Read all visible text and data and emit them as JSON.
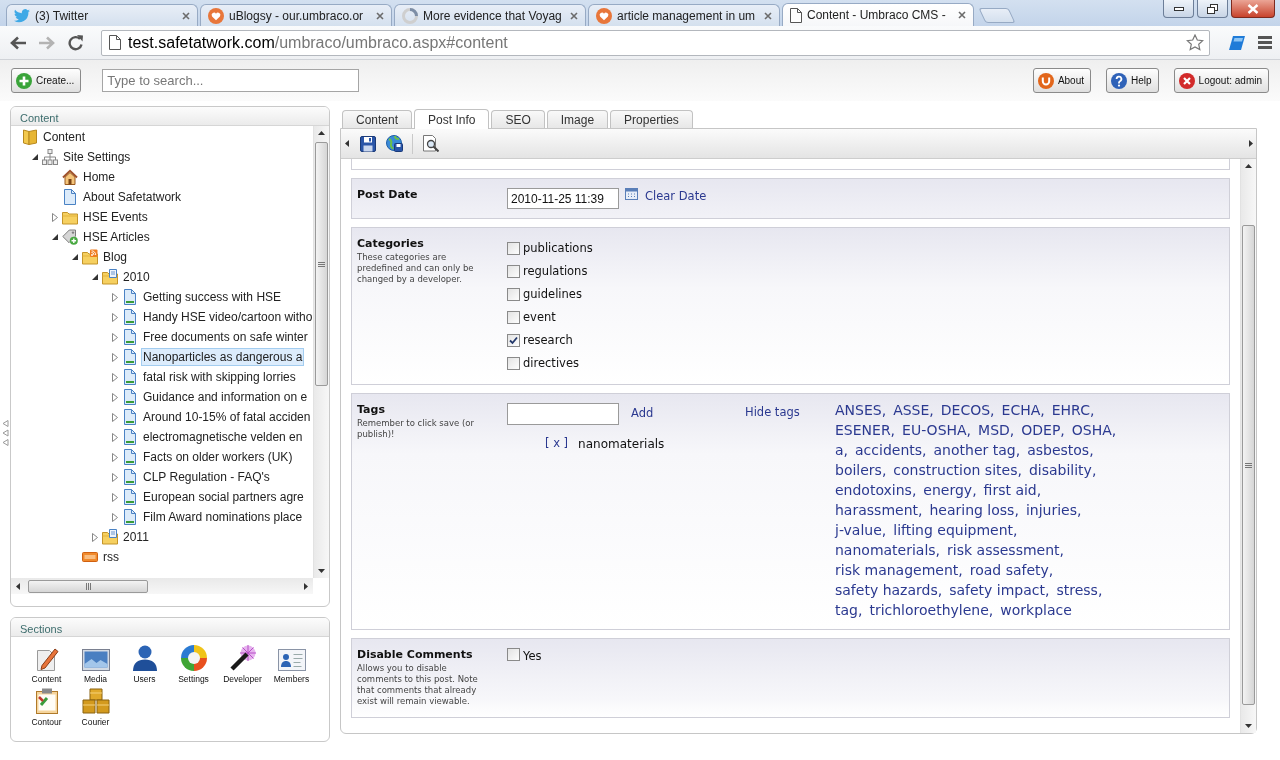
{
  "browser": {
    "tabs": [
      {
        "kind": "bird",
        "title": "(3) Twitter",
        "selected": false
      },
      {
        "kind": "heart",
        "title": "uBlogsy - our.umbraco.or",
        "selected": false
      },
      {
        "kind": "loading",
        "title": "More evidence that Voyag",
        "selected": false
      },
      {
        "kind": "heart",
        "title": "article management in um",
        "selected": false
      },
      {
        "kind": "page",
        "title": "Content - Umbraco CMS -",
        "selected": true
      }
    ],
    "address": {
      "host": "test.safetatwork.com",
      "path": "/umbraco/umbraco.aspx#content"
    }
  },
  "header": {
    "create_button": "Create...",
    "search": {
      "placeholder": "Type to search..."
    },
    "buttons": [
      {
        "kind": "about",
        "label": "About"
      },
      {
        "kind": "help",
        "label": "Help"
      },
      {
        "kind": "logout",
        "label": "Logout: admin"
      }
    ]
  },
  "content_tree": {
    "title": "Content",
    "items": [
      {
        "kind": "root",
        "label": "Content",
        "selected": false,
        "children": [
          {
            "kind": "settings",
            "label": "Site Settings",
            "expanded": true,
            "selected": false,
            "children": [
              {
                "kind": "home",
                "label": "Home",
                "selected": false
              },
              {
                "kind": "page",
                "label": "About Safetatwork",
                "selected": false
              },
              {
                "kind": "folder",
                "label": "HSE Events",
                "expanded": false,
                "selected": false
              },
              {
                "kind": "articles",
                "label": "HSE Articles",
                "expanded": true,
                "selected": false,
                "children": [
                  {
                    "kind": "blog",
                    "label": "Blog",
                    "expanded": true,
                    "selected": false,
                    "children": [
                      {
                        "kind": "year",
                        "label": "2010",
                        "expanded": true,
                        "selected": false,
                        "children": [
                          {
                            "kind": "post",
                            "label": "Getting success with HSE",
                            "expanded": false,
                            "selected": false
                          },
                          {
                            "kind": "post",
                            "label": "Handy HSE video/cartoon witho",
                            "expanded": false,
                            "selected": false
                          },
                          {
                            "kind": "post",
                            "label": "Free documents on safe winter",
                            "expanded": false,
                            "selected": false
                          },
                          {
                            "kind": "post",
                            "label": "Nanoparticles as dangerous a",
                            "expanded": false,
                            "selected": true
                          },
                          {
                            "kind": "post",
                            "label": "fatal risk with skipping lorries",
                            "expanded": false,
                            "selected": false
                          },
                          {
                            "kind": "post",
                            "label": "Guidance and information on e",
                            "expanded": false,
                            "selected": false
                          },
                          {
                            "kind": "post",
                            "label": "Around 10-15% of fatal acciden",
                            "expanded": false,
                            "selected": false
                          },
                          {
                            "kind": "post",
                            "label": "electromagnetische velden en",
                            "expanded": false,
                            "selected": false
                          },
                          {
                            "kind": "post",
                            "label": "Facts on older workers (UK)",
                            "expanded": false,
                            "selected": false
                          },
                          {
                            "kind": "post",
                            "label": "CLP Regulation - FAQ's",
                            "expanded": false,
                            "selected": false
                          },
                          {
                            "kind": "post",
                            "label": "European social partners agre",
                            "expanded": false,
                            "selected": false
                          },
                          {
                            "kind": "post",
                            "label": "Film Award nominations place",
                            "expanded": false,
                            "selected": false
                          }
                        ]
                      },
                      {
                        "kind": "year",
                        "label": "2011",
                        "expanded": false,
                        "selected": false
                      }
                    ]
                  },
                  {
                    "kind": "rss",
                    "label": "rss",
                    "selected": false
                  }
                ]
              }
            ]
          }
        ]
      }
    ]
  },
  "sections": {
    "title": "Sections",
    "items": [
      {
        "kind": "content",
        "label": "Content"
      },
      {
        "kind": "media",
        "label": "Media"
      },
      {
        "kind": "users",
        "label": "Users"
      },
      {
        "kind": "settings",
        "label": "Settings"
      },
      {
        "kind": "developer",
        "label": "Developer"
      },
      {
        "kind": "members",
        "label": "Members"
      },
      {
        "kind": "contour",
        "label": "Contour"
      },
      {
        "kind": "courier",
        "label": "Courier"
      }
    ]
  },
  "editor": {
    "tabs": [
      {
        "label": "Content",
        "selected": false
      },
      {
        "label": "Post Info",
        "selected": true
      },
      {
        "label": "SEO",
        "selected": false
      },
      {
        "label": "Image",
        "selected": false
      },
      {
        "label": "Properties",
        "selected": false
      }
    ],
    "post_date": {
      "label": "Post Date",
      "value": "2010-11-25 11:39",
      "clear_link": "Clear Date"
    },
    "categories": {
      "label": "Categories",
      "description": "These categories are predefined and can only be changed by a developer.",
      "options": [
        {
          "label": "publications",
          "checked": false
        },
        {
          "label": "regulations",
          "checked": false
        },
        {
          "label": "guidelines",
          "checked": false
        },
        {
          "label": "event",
          "checked": false
        },
        {
          "label": "research",
          "checked": true
        },
        {
          "label": "directives",
          "checked": false
        }
      ]
    },
    "tags": {
      "label": "Tags",
      "description": "Remember to click save (or publish)!",
      "add_link": "Add",
      "hide_link": "Hide tags",
      "selected_tags": [
        {
          "remove": "[ x ]",
          "label": "nanomaterials"
        }
      ],
      "cloud": [
        "ANSES,",
        "ASSE,",
        "DECOS,",
        "ECHA,",
        "EHRC,",
        "ESENER,",
        "EU-OSHA,",
        "MSD,",
        "ODEP,",
        "OSHA,",
        "a,",
        "accidents,",
        "another tag,",
        "asbestos,",
        "boilers,",
        "construction sites,",
        "disability,",
        "endotoxins,",
        "energy,",
        "first aid,",
        "harassment,",
        "hearing loss,",
        "injuries,",
        "j-value,",
        "lifting equipment,",
        "nanomaterials,",
        "risk assessment,",
        "risk management,",
        "road safety,",
        "safety hazards,",
        "safety impact,",
        "stress,",
        "tag,",
        "trichloroethylene,",
        "workplace"
      ]
    },
    "disable_comments": {
      "label": "Disable Comments",
      "description": "Allows you to disable comments to this post. Note that comments that already exist will remain viewable.",
      "option": {
        "label": "Yes",
        "checked": false
      }
    }
  }
}
